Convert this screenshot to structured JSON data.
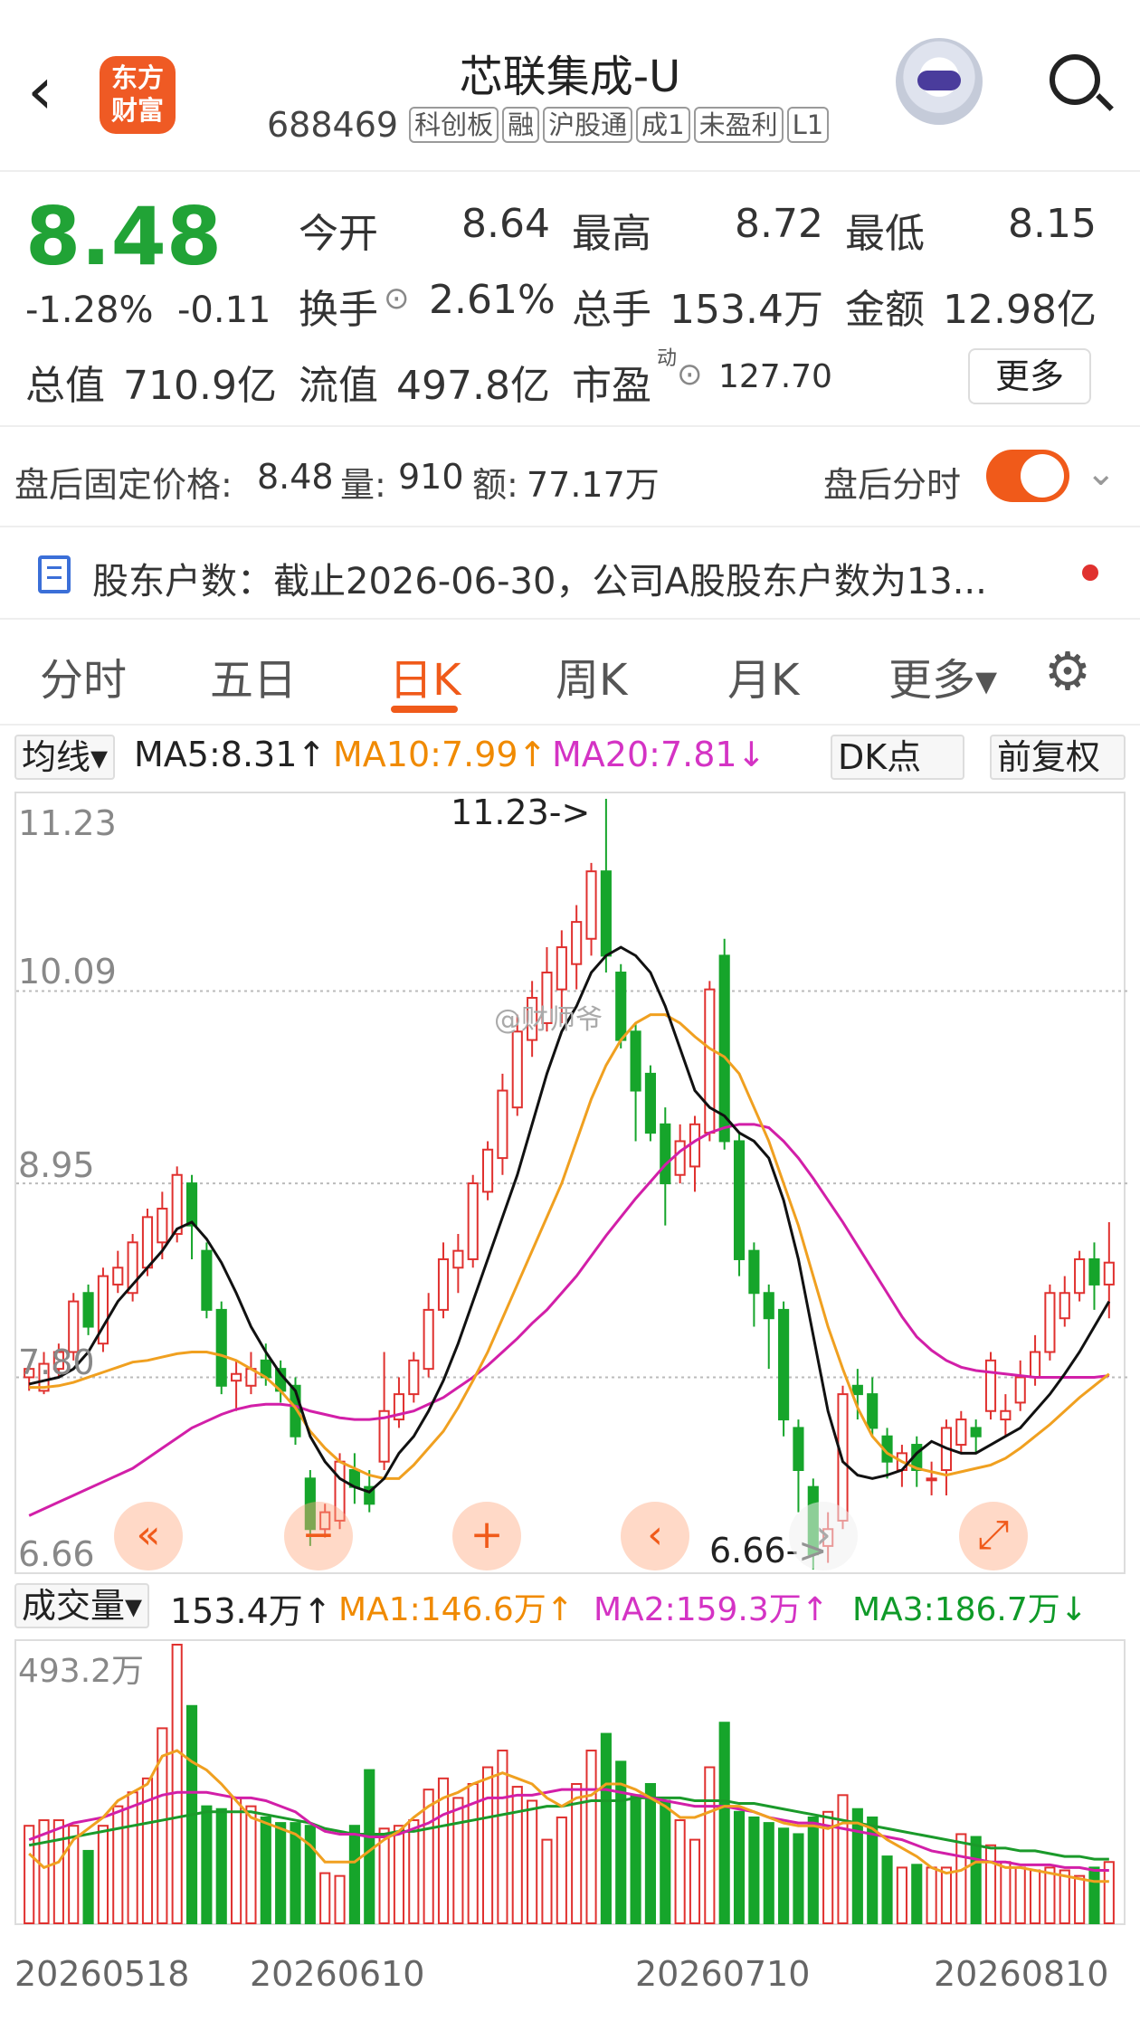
{
  "header": {
    "back_icon": "chevron-left-icon",
    "logo_line1": "东方",
    "logo_line2": "财富",
    "title": "芯联集成-U",
    "code": "688469",
    "tags": [
      "科创板",
      "融",
      "沪股通",
      "成1",
      "未盈利",
      "L1"
    ]
  },
  "quote": {
    "price": "8.48",
    "change_pct": "-1.28%",
    "change": "-0.11",
    "open_label": "今开",
    "open": "8.64",
    "high_label": "最高",
    "high": "8.72",
    "low_label": "最低",
    "low": "8.15",
    "turnover_label": "换手",
    "turnover": "2.61%",
    "volume_label": "总手",
    "volume": "153.4万",
    "amount_label": "金额",
    "amount": "12.98亿",
    "mcap_label": "总值",
    "mcap": "710.9亿",
    "float_label": "流值",
    "float": "497.8亿",
    "pe_label": "市盈",
    "pe_sup": "动",
    "pe": "127.70",
    "more": "更多"
  },
  "after_hours": {
    "label": "盘后固定价格:",
    "price": "8.48",
    "vol_label": "量:",
    "vol": "910",
    "amt_label": "额:",
    "amt": "77.17万",
    "toggle_label": "盘后分时"
  },
  "notice": {
    "text": "股东户数：截止2026-06-30，公司A股股东户数为13..."
  },
  "tabs": [
    "分时",
    "五日",
    "日K",
    "周K",
    "月K",
    "更多▾"
  ],
  "indicators": {
    "selector": "均线▾",
    "ma5": "MA5:8.31↑",
    "ma10": "MA10:7.99↑",
    "ma20": "MA20:7.81↓",
    "dk": "DK点",
    "adj": "前复权"
  },
  "vol_indicators": {
    "selector": "成交量▾",
    "vol": "153.4万↑",
    "ma1": "MA1:146.6万↑",
    "ma2": "MA2:159.3万↑",
    "ma3": "MA3:186.7万↓"
  },
  "chart_data": {
    "type": "candlestick",
    "y_ticks": [
      "11.23",
      "10.09",
      "8.95",
      "7.80",
      "6.66"
    ],
    "ylim": [
      6.66,
      11.23
    ],
    "annot_high": "11.23->",
    "annot_low": "6.66->",
    "watermark": "@财师爷",
    "vol_max": "493.2万",
    "dates": [
      "20260518",
      "20260610",
      "20260710",
      "20260810"
    ],
    "candles": [
      [
        7.8,
        7.85,
        7.72,
        7.88
      ],
      [
        7.72,
        7.88,
        7.7,
        7.95
      ],
      [
        7.85,
        7.95,
        7.8,
        8.0
      ],
      [
        7.95,
        8.25,
        7.9,
        8.3
      ],
      [
        8.3,
        8.1,
        8.05,
        8.35
      ],
      [
        8.0,
        8.4,
        7.95,
        8.45
      ],
      [
        8.35,
        8.45,
        8.3,
        8.55
      ],
      [
        8.3,
        8.6,
        8.25,
        8.65
      ],
      [
        8.45,
        8.75,
        8.4,
        8.8
      ],
      [
        8.6,
        8.8,
        8.5,
        8.9
      ],
      [
        8.65,
        9.0,
        8.6,
        9.05
      ],
      [
        8.95,
        8.7,
        8.5,
        9.0
      ],
      [
        8.55,
        8.2,
        8.15,
        8.6
      ],
      [
        8.2,
        7.75,
        7.7,
        8.25
      ],
      [
        7.78,
        7.82,
        7.6,
        7.9
      ],
      [
        7.75,
        7.85,
        7.7,
        7.95
      ],
      [
        7.9,
        7.8,
        7.75,
        8.0
      ],
      [
        7.85,
        7.72,
        7.65,
        7.9
      ],
      [
        7.75,
        7.45,
        7.4,
        7.8
      ],
      [
        7.2,
        6.9,
        6.8,
        7.25
      ],
      [
        6.9,
        7.0,
        6.85,
        7.05
      ],
      [
        6.95,
        7.3,
        6.9,
        7.35
      ],
      [
        7.25,
        7.15,
        7.05,
        7.35
      ],
      [
        7.15,
        7.05,
        7.0,
        7.25
      ],
      [
        7.3,
        7.6,
        7.25,
        7.95
      ],
      [
        7.55,
        7.7,
        7.5,
        7.8
      ],
      [
        7.7,
        7.9,
        7.65,
        7.95
      ],
      [
        7.85,
        8.2,
        7.8,
        8.3
      ],
      [
        8.2,
        8.5,
        8.15,
        8.6
      ],
      [
        8.45,
        8.55,
        8.3,
        8.65
      ],
      [
        8.5,
        8.95,
        8.45,
        9.0
      ],
      [
        8.9,
        9.15,
        8.85,
        9.2
      ],
      [
        9.1,
        9.5,
        9.0,
        9.6
      ],
      [
        9.4,
        9.85,
        9.35,
        9.95
      ],
      [
        9.8,
        10.05,
        9.7,
        10.15
      ],
      [
        9.9,
        10.2,
        9.85,
        10.35
      ],
      [
        10.1,
        10.35,
        9.9,
        10.45
      ],
      [
        10.25,
        10.5,
        10.1,
        10.6
      ],
      [
        10.4,
        10.8,
        10.3,
        10.85
      ],
      [
        10.8,
        10.3,
        10.2,
        11.23
      ],
      [
        10.2,
        9.8,
        9.75,
        10.25
      ],
      [
        9.85,
        9.5,
        9.2,
        9.9
      ],
      [
        9.6,
        9.25,
        9.2,
        9.65
      ],
      [
        9.3,
        8.95,
        8.7,
        9.4
      ],
      [
        9.0,
        9.2,
        8.95,
        9.3
      ],
      [
        9.05,
        9.3,
        8.9,
        9.35
      ],
      [
        9.25,
        10.1,
        9.2,
        10.15
      ],
      [
        10.3,
        9.2,
        9.15,
        10.4
      ],
      [
        9.2,
        8.5,
        8.4,
        9.25
      ],
      [
        8.55,
        8.3,
        8.1,
        8.6
      ],
      [
        8.3,
        8.15,
        7.85,
        8.35
      ],
      [
        8.2,
        7.55,
        7.45,
        8.25
      ],
      [
        7.5,
        7.25,
        7.0,
        7.55
      ],
      [
        7.15,
        6.75,
        6.66,
        7.2
      ],
      [
        6.8,
        6.9,
        6.7,
        7.0
      ],
      [
        6.95,
        7.7,
        6.9,
        7.75
      ],
      [
        7.75,
        7.7,
        7.55,
        7.85
      ],
      [
        7.7,
        7.5,
        7.45,
        7.8
      ],
      [
        7.45,
        7.3,
        7.2,
        7.5
      ],
      [
        7.25,
        7.35,
        7.15,
        7.4
      ],
      [
        7.4,
        7.25,
        7.15,
        7.45
      ],
      [
        7.2,
        7.2,
        7.1,
        7.3
      ],
      [
        7.25,
        7.5,
        7.1,
        7.55
      ],
      [
        7.4,
        7.55,
        7.35,
        7.6
      ],
      [
        7.5,
        7.45,
        7.35,
        7.55
      ],
      [
        7.6,
        7.9,
        7.55,
        7.95
      ],
      [
        7.55,
        7.6,
        7.45,
        7.7
      ],
      [
        7.65,
        7.8,
        7.6,
        7.9
      ],
      [
        7.8,
        7.95,
        7.75,
        8.05
      ],
      [
        7.95,
        8.3,
        7.9,
        8.35
      ],
      [
        8.15,
        8.3,
        8.1,
        8.4
      ],
      [
        8.3,
        8.5,
        8.25,
        8.55
      ],
      [
        8.5,
        8.35,
        8.2,
        8.6
      ],
      [
        8.35,
        8.48,
        8.15,
        8.72
      ]
    ],
    "ma5": [
      7.76,
      7.78,
      7.8,
      7.85,
      7.95,
      8.1,
      8.25,
      8.35,
      8.45,
      8.55,
      8.68,
      8.72,
      8.62,
      8.48,
      8.3,
      8.1,
      7.95,
      7.82,
      7.72,
      7.45,
      7.3,
      7.2,
      7.15,
      7.12,
      7.2,
      7.35,
      7.45,
      7.6,
      7.78,
      8.0,
      8.25,
      8.5,
      8.75,
      9.0,
      9.3,
      9.6,
      9.85,
      10.0,
      10.2,
      10.3,
      10.35,
      10.3,
      10.2,
      10.0,
      9.75,
      9.5,
      9.4,
      9.35,
      9.25,
      9.2,
      9.1,
      8.85,
      8.5,
      8.05,
      7.6,
      7.3,
      7.22,
      7.2,
      7.22,
      7.25,
      7.35,
      7.42,
      7.38,
      7.35,
      7.35,
      7.4,
      7.45,
      7.5,
      7.6,
      7.7,
      7.82,
      7.95,
      8.1,
      8.25
    ],
    "ma10": [
      7.74,
      7.74,
      7.75,
      7.77,
      7.8,
      7.83,
      7.86,
      7.89,
      7.9,
      7.92,
      7.94,
      7.95,
      7.95,
      7.93,
      7.9,
      7.85,
      7.8,
      7.72,
      7.62,
      7.48,
      7.38,
      7.3,
      7.26,
      7.22,
      7.2,
      7.2,
      7.28,
      7.38,
      7.48,
      7.62,
      7.78,
      7.95,
      8.15,
      8.35,
      8.55,
      8.75,
      8.95,
      9.2,
      9.45,
      9.65,
      9.8,
      9.9,
      9.95,
      9.95,
      9.9,
      9.82,
      9.75,
      9.7,
      9.6,
      9.4,
      9.2,
      8.95,
      8.7,
      8.4,
      8.1,
      7.85,
      7.62,
      7.45,
      7.35,
      7.3,
      7.26,
      7.24,
      7.22,
      7.24,
      7.26,
      7.28,
      7.32,
      7.38,
      7.45,
      7.52,
      7.6,
      7.68,
      7.75,
      7.82
    ],
    "ma20": [
      6.98,
      7.02,
      7.06,
      7.1,
      7.14,
      7.18,
      7.22,
      7.26,
      7.32,
      7.38,
      7.44,
      7.5,
      7.54,
      7.58,
      7.61,
      7.63,
      7.64,
      7.64,
      7.63,
      7.6,
      7.58,
      7.56,
      7.55,
      7.55,
      7.56,
      7.58,
      7.6,
      7.64,
      7.68,
      7.74,
      7.8,
      7.87,
      7.95,
      8.03,
      8.12,
      8.2,
      8.3,
      8.4,
      8.52,
      8.64,
      8.75,
      8.86,
      8.96,
      9.06,
      9.14,
      9.2,
      9.25,
      9.28,
      9.3,
      9.3,
      9.28,
      9.2,
      9.1,
      8.98,
      8.85,
      8.72,
      8.58,
      8.44,
      8.3,
      8.16,
      8.04,
      7.96,
      7.9,
      7.86,
      7.84,
      7.83,
      7.82,
      7.81,
      7.8,
      7.8,
      7.8,
      7.8,
      7.8,
      7.81
    ],
    "volume": [
      0.35,
      0.37,
      0.37,
      0.35,
      0.26,
      0.35,
      0.42,
      0.47,
      0.52,
      0.7,
      1.0,
      0.78,
      0.42,
      0.41,
      0.45,
      0.42,
      0.38,
      0.36,
      0.36,
      0.35,
      0.18,
      0.17,
      0.35,
      0.55,
      0.34,
      0.35,
      0.37,
      0.48,
      0.52,
      0.45,
      0.5,
      0.56,
      0.62,
      0.49,
      0.44,
      0.3,
      0.38,
      0.5,
      0.62,
      0.68,
      0.58,
      0.46,
      0.5,
      0.44,
      0.37,
      0.3,
      0.56,
      0.72,
      0.4,
      0.38,
      0.36,
      0.34,
      0.32,
      0.38,
      0.4,
      0.46,
      0.41,
      0.38,
      0.24,
      0.2,
      0.21,
      0.2,
      0.2,
      0.32,
      0.31,
      0.28,
      0.22,
      0.2,
      0.19,
      0.2,
      0.19,
      0.17,
      0.2,
      0.22
    ],
    "vma1": [
      0.25,
      0.2,
      0.22,
      0.3,
      0.34,
      0.38,
      0.44,
      0.47,
      0.5,
      0.6,
      0.62,
      0.58,
      0.55,
      0.5,
      0.44,
      0.38,
      0.36,
      0.34,
      0.32,
      0.28,
      0.22,
      0.22,
      0.22,
      0.26,
      0.3,
      0.33,
      0.38,
      0.42,
      0.45,
      0.47,
      0.5,
      0.52,
      0.54,
      0.52,
      0.5,
      0.45,
      0.42,
      0.45,
      0.46,
      0.5,
      0.5,
      0.48,
      0.45,
      0.42,
      0.38,
      0.38,
      0.4,
      0.42,
      0.42,
      0.4,
      0.38,
      0.36,
      0.35,
      0.35,
      0.34,
      0.36,
      0.36,
      0.34,
      0.3,
      0.27,
      0.24,
      0.2,
      0.18,
      0.19,
      0.22,
      0.22,
      0.2,
      0.2,
      0.19,
      0.18,
      0.17,
      0.16,
      0.15,
      0.15
    ],
    "vma2": [
      0.3,
      0.32,
      0.34,
      0.36,
      0.37,
      0.38,
      0.4,
      0.42,
      0.44,
      0.46,
      0.47,
      0.47,
      0.47,
      0.46,
      0.45,
      0.45,
      0.44,
      0.42,
      0.4,
      0.36,
      0.33,
      0.32,
      0.32,
      0.31,
      0.31,
      0.32,
      0.34,
      0.36,
      0.39,
      0.41,
      0.43,
      0.45,
      0.45,
      0.46,
      0.46,
      0.47,
      0.48,
      0.48,
      0.48,
      0.48,
      0.47,
      0.46,
      0.45,
      0.44,
      0.43,
      0.42,
      0.42,
      0.42,
      0.41,
      0.4,
      0.38,
      0.37,
      0.36,
      0.36,
      0.35,
      0.34,
      0.33,
      0.32,
      0.31,
      0.3,
      0.28,
      0.26,
      0.25,
      0.24,
      0.23,
      0.22,
      0.22,
      0.21,
      0.21,
      0.21,
      0.2,
      0.2,
      0.19,
      0.19
    ],
    "vma3": [
      0.28,
      0.29,
      0.3,
      0.31,
      0.32,
      0.33,
      0.34,
      0.35,
      0.36,
      0.37,
      0.38,
      0.39,
      0.4,
      0.4,
      0.4,
      0.4,
      0.39,
      0.38,
      0.37,
      0.36,
      0.34,
      0.33,
      0.32,
      0.32,
      0.32,
      0.33,
      0.33,
      0.34,
      0.35,
      0.36,
      0.37,
      0.38,
      0.39,
      0.4,
      0.41,
      0.42,
      0.42,
      0.43,
      0.44,
      0.44,
      0.44,
      0.45,
      0.45,
      0.45,
      0.45,
      0.44,
      0.44,
      0.44,
      0.43,
      0.43,
      0.42,
      0.41,
      0.4,
      0.39,
      0.38,
      0.37,
      0.36,
      0.35,
      0.34,
      0.33,
      0.32,
      0.31,
      0.3,
      0.29,
      0.28,
      0.27,
      0.27,
      0.26,
      0.26,
      0.25,
      0.24,
      0.24,
      0.23,
      0.23
    ]
  }
}
